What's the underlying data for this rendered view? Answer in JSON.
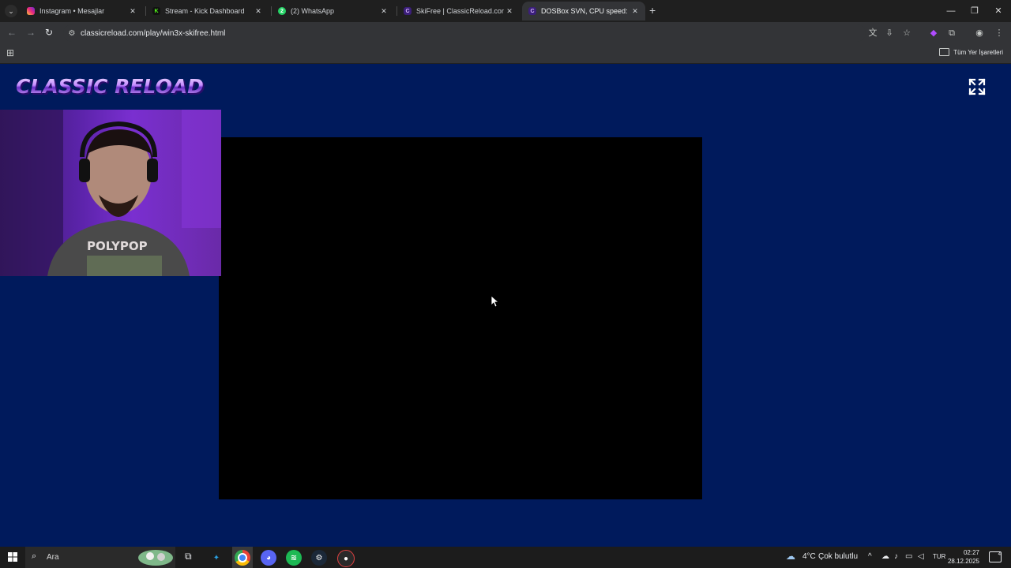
{
  "browser": {
    "tabs": [
      {
        "title": "Instagram • Mesajlar",
        "icon": "instagram-icon",
        "color": "#e1306c"
      },
      {
        "title": "Stream - Kick Dashboard",
        "icon": "kick-icon",
        "color": "#53fc18"
      },
      {
        "title": "(2) WhatsApp",
        "icon": "whatsapp-icon",
        "color": "#25d366"
      },
      {
        "title": "SkiFree | ClassicReload.com",
        "icon": "classicreload-icon",
        "color": "#6a3cc8"
      },
      {
        "title": "DOSBox SVN, CPU speed: max",
        "icon": "dosbox-icon",
        "color": "#6a3cc8"
      }
    ],
    "url": "classicreload.com/play/win3x-skifree.html",
    "bookmarks_all_label": "Tüm Yer İşaretleri"
  },
  "page": {
    "logo_text": "CLASSIC RELOAD",
    "fullscreen_icon": "fullscreen-icon"
  },
  "taskbar": {
    "search_label": "Ara",
    "weather_temp": "4°C",
    "weather_desc": "Çok bulutlu",
    "language": "TUR",
    "time": "02:27",
    "date": "28.12.2025",
    "notification_count": "4"
  }
}
